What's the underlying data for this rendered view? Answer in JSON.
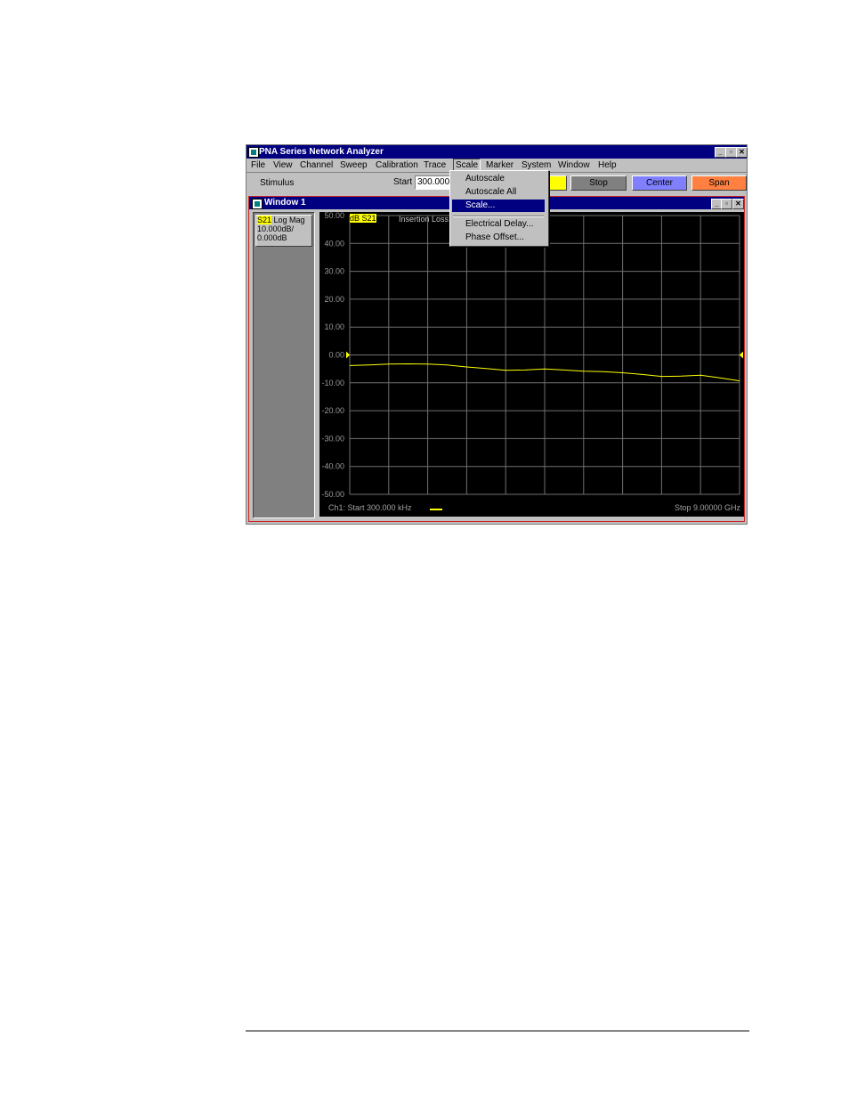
{
  "app": {
    "title": "PNA Series Network Analyzer",
    "menu": [
      "File",
      "View",
      "Channel",
      "Sweep",
      "Calibration",
      "Trace",
      "Scale",
      "Marker",
      "System",
      "Window",
      "Help"
    ],
    "caption_min": "_",
    "caption_max": "▫",
    "caption_close": "✕"
  },
  "toolbar": {
    "stimulus_label": "Stimulus",
    "start_label": "Start",
    "start_value": "300.000",
    "stop_label": "Stop",
    "center_label": "Center",
    "span_label": "Span"
  },
  "scale_menu": {
    "items": [
      "Autoscale",
      "Autoscale All",
      "Scale...",
      "Electrical Delay...",
      "Phase Offset..."
    ],
    "selected": "Scale..."
  },
  "child_window": {
    "title": "Window 1",
    "trace": {
      "param": "S21",
      "format": "Log Mag",
      "scale": "10.000dB/",
      "ref": "0.000dB"
    },
    "trace_tag": "dB S21",
    "trace_title": "Insertion Loss",
    "footer_start": "Ch1: Start  300.000 kHz",
    "footer_stop": "Stop  9.00000 GHz"
  },
  "chart_data": {
    "type": "line",
    "ylim": [
      -50,
      50
    ],
    "yticks": [
      "50.00",
      "40.00",
      "30.00",
      "20.00",
      "10.00",
      "0.00",
      "-10.00",
      "-20.00",
      "-30.00",
      "-40.00",
      "-50.00"
    ],
    "grid": true,
    "xdivisions": 10,
    "series": [
      {
        "color": "#ffff00",
        "x": [
          0,
          0.5,
          1,
          1.5,
          2,
          2.5,
          3,
          3.5,
          4,
          4.5,
          5,
          5.5,
          6,
          6.5,
          7,
          7.5,
          8,
          8.5,
          9,
          9.5,
          10
        ],
        "values": [
          -3.8,
          -3.6,
          -3.3,
          -3.2,
          -3.3,
          -3.6,
          -4.3,
          -4.9,
          -5.5,
          -5.4,
          -5.0,
          -5.4,
          -5.8,
          -6.0,
          -6.4,
          -7.0,
          -7.7,
          -7.6,
          -7.3,
          -8.2,
          -9.3
        ]
      }
    ]
  }
}
